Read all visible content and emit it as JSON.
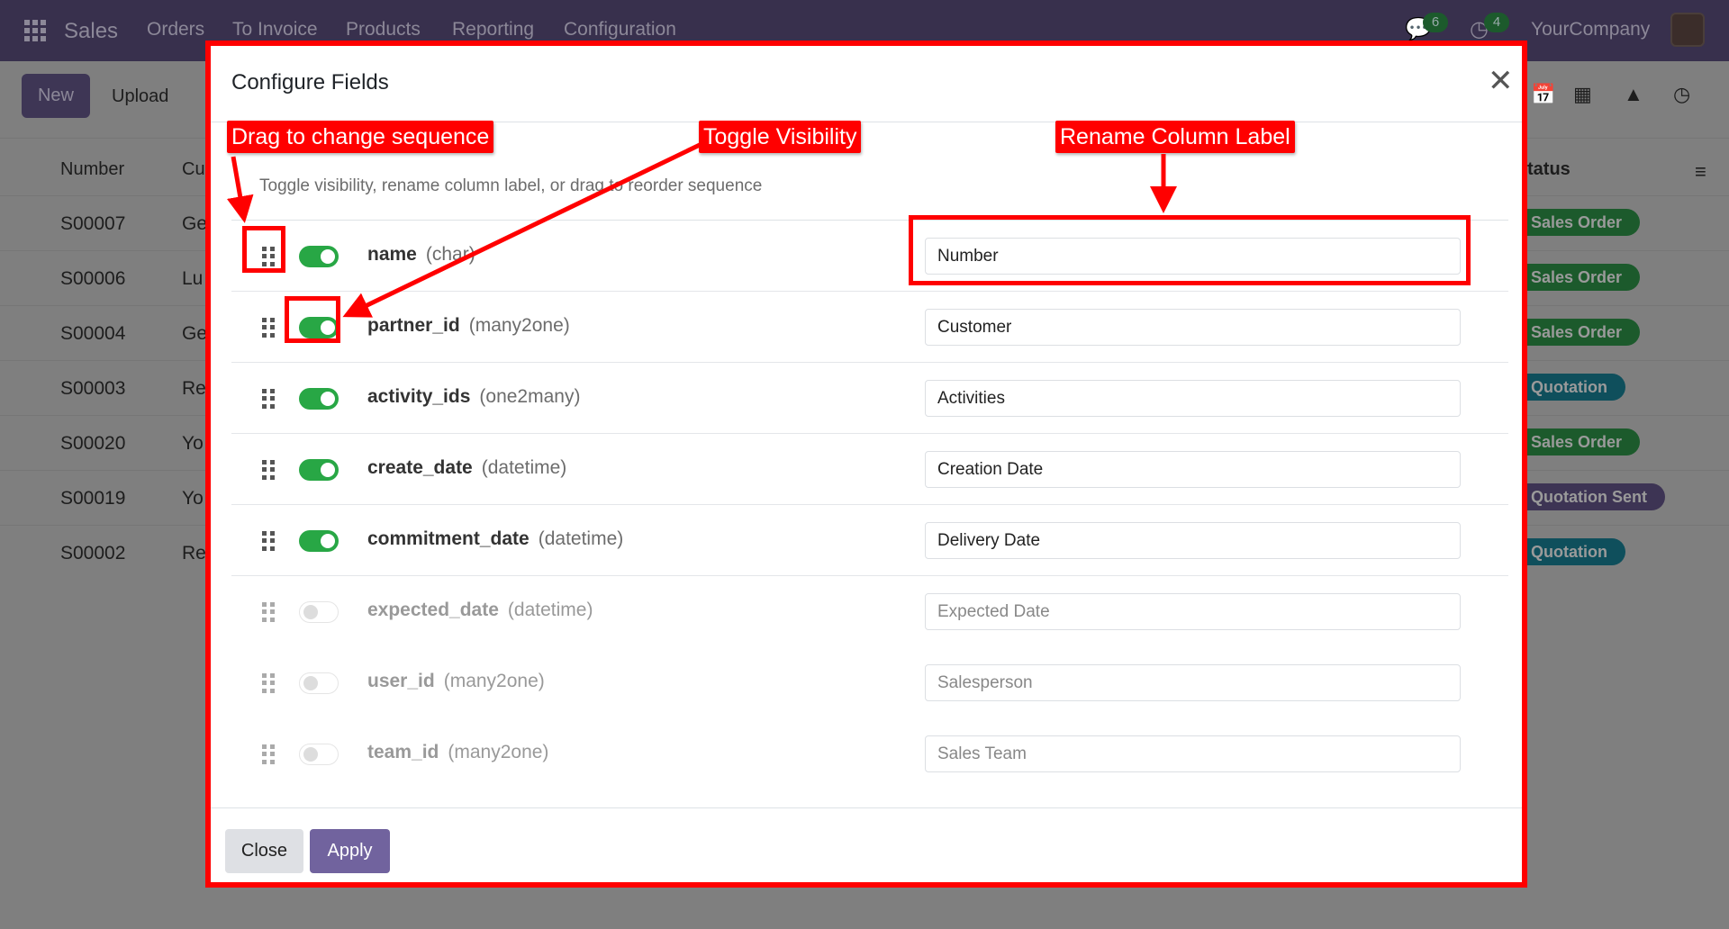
{
  "navbar": {
    "app": "Sales",
    "menu": [
      "Orders",
      "To Invoice",
      "Products",
      "Reporting",
      "Configuration"
    ],
    "messages_count": "6",
    "activities_count": "4",
    "company": "YourCompany"
  },
  "toolbar": {
    "new": "New",
    "upload": "Upload"
  },
  "list": {
    "headers": {
      "number": "Number",
      "customer": "Cu",
      "status": "tatus"
    },
    "rows": [
      {
        "number": "S00007",
        "customer": "Ge",
        "status": "Sales Order",
        "color": "#1c5a2c"
      },
      {
        "number": "S00006",
        "customer": "Lu",
        "status": "Sales Order",
        "color": "#1c5a2c"
      },
      {
        "number": "S00004",
        "customer": "Ge",
        "status": "Sales Order",
        "color": "#1c5a2c"
      },
      {
        "number": "S00003",
        "customer": "Re",
        "status": "Quotation",
        "color": "#0f4f5c"
      },
      {
        "number": "S00020",
        "customer": "Yo",
        "status": "Sales Order",
        "color": "#1c5a2c"
      },
      {
        "number": "S00019",
        "customer": "Yo",
        "status": "Quotation Sent",
        "color": "#3d3454"
      },
      {
        "number": "S00002",
        "customer": "Re",
        "status": "Quotation",
        "color": "#0f4f5c"
      }
    ]
  },
  "modal": {
    "title": "Configure Fields",
    "subtitle": "Toggle visibility, rename column label, or drag to reorder sequence",
    "fields": [
      {
        "name": "name",
        "type": "(char)",
        "label": "Number",
        "visible": true
      },
      {
        "name": "partner_id",
        "type": "(many2one)",
        "label": "Customer",
        "visible": true
      },
      {
        "name": "activity_ids",
        "type": "(one2many)",
        "label": "Activities",
        "visible": true
      },
      {
        "name": "create_date",
        "type": "(datetime)",
        "label": "Creation Date",
        "visible": true
      },
      {
        "name": "commitment_date",
        "type": "(datetime)",
        "label": "Delivery Date",
        "visible": true
      },
      {
        "name": "expected_date",
        "type": "(datetime)",
        "label": "Expected Date",
        "visible": false
      },
      {
        "name": "user_id",
        "type": "(many2one)",
        "label": "Salesperson",
        "visible": false
      },
      {
        "name": "team_id",
        "type": "(many2one)",
        "label": "Sales Team",
        "visible": false
      }
    ],
    "close": "Close",
    "apply": "Apply"
  },
  "annotations": {
    "drag": "Drag to change sequence",
    "toggle": "Toggle Visibility",
    "rename": "Rename Column Label"
  }
}
